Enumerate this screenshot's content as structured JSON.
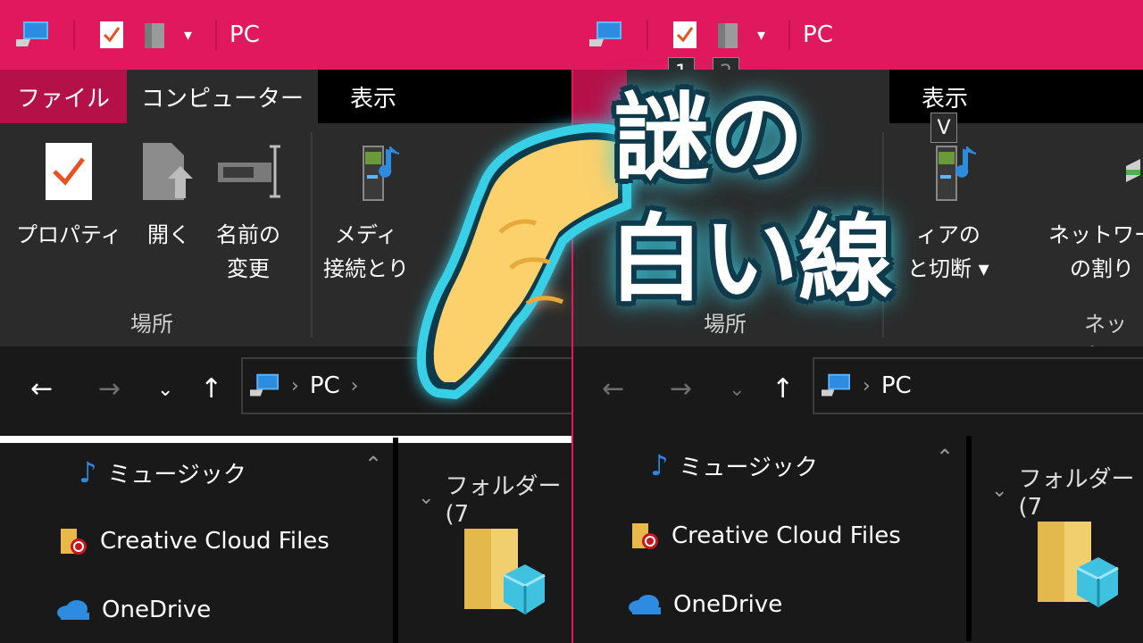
{
  "title": "PC",
  "tabs": {
    "file": "ファイル",
    "computer": "コンピューター",
    "view": "表示"
  },
  "ribbon": {
    "properties": "プロパティ",
    "open": "開く",
    "rename_line1": "名前の",
    "rename_line2": "変更",
    "media_line1": "メディ",
    "media_line2": "接続とり",
    "group_location": "場所",
    "right_media_line1": "ィアの",
    "right_media_line2": "と切断",
    "network_line1": "ネットワー",
    "network_line2": "の割り",
    "group_network": "ネット"
  },
  "keytips": {
    "one": "1",
    "two": "2",
    "v": "V"
  },
  "address": {
    "root": "PC"
  },
  "nav": {
    "music": "ミュージック",
    "creative_cloud": "Creative Cloud Files",
    "onedrive": "OneDrive"
  },
  "content": {
    "folders_header": "フォルダー (7"
  },
  "overlay": {
    "line1": "謎の",
    "line2": "白い線"
  },
  "colors": {
    "accent": "#e0185e",
    "ribbon": "#2b2b2b",
    "glow": "#39d0e6"
  }
}
